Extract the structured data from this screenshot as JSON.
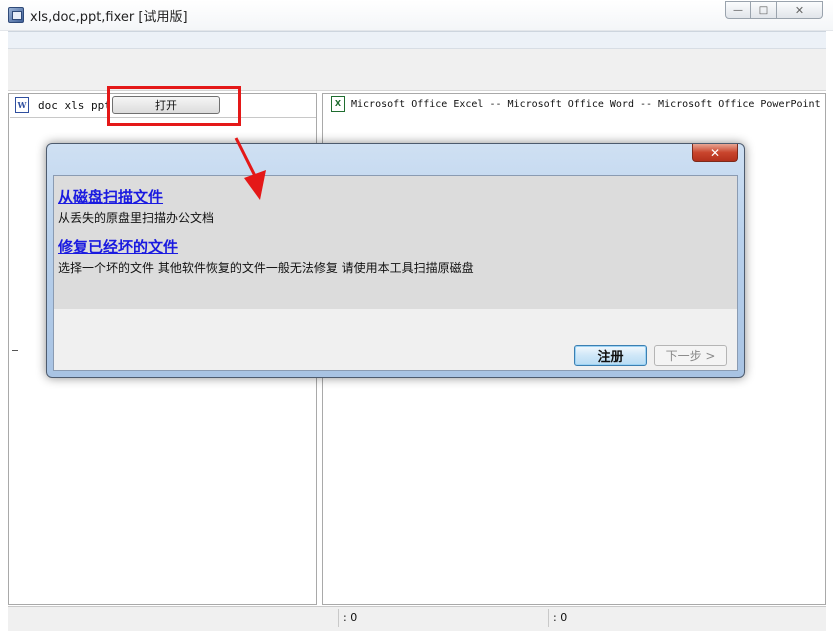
{
  "window": {
    "title": "xls,doc,ppt,fixer [试用版]",
    "minimize_glyph": "—",
    "maximize_glyph": "□",
    "close_glyph": "✕"
  },
  "left_pane": {
    "label": "doc xls ppt",
    "open_button": "打开",
    "doc_icon_text": "W"
  },
  "right_pane": {
    "xls_icon_text": "X",
    "header": "Microsoft Office Excel -- Microsoft Office Word -- Microsoft Office PowerPoint"
  },
  "statusbar": {
    "cell1": ": 0",
    "cell2": ": 0"
  },
  "dialog": {
    "close_glyph": "✕",
    "options": [
      {
        "title": "从磁盘扫描文件",
        "description": "从丢失的原盘里扫描办公文档"
      },
      {
        "title": "修复已经坏的文件",
        "description": "选择一个坏的文件 其他软件恢复的文件一般无法修复 请使用本工具扫描原磁盘"
      }
    ],
    "register_button": "注册",
    "next_button": "下一步 >"
  },
  "colors": {
    "highlight": "#e41818",
    "link": "#1a1ae0",
    "dialog_frame": "#b9d1ec"
  }
}
